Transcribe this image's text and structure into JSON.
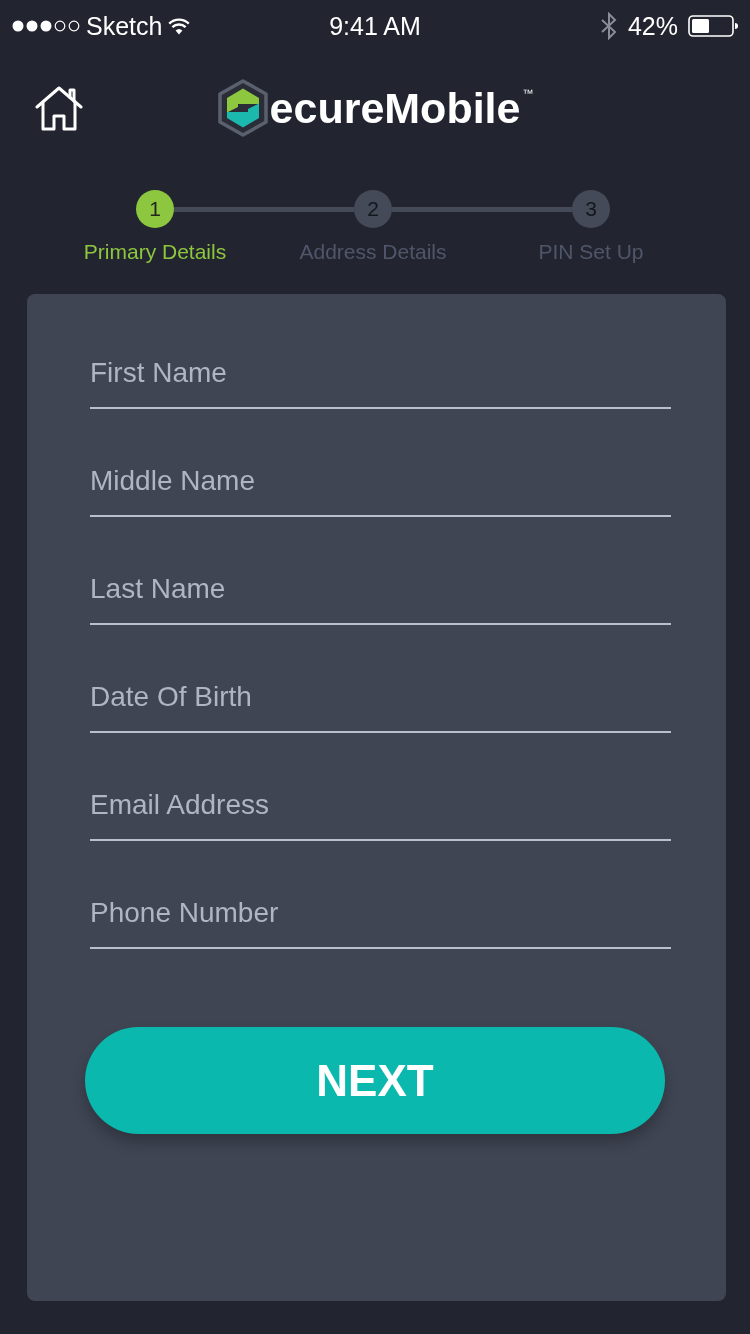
{
  "status_bar": {
    "carrier": "Sketch",
    "time": "9:41 AM",
    "battery": "42%"
  },
  "header": {
    "logo_text": "ecureMobile",
    "trademark": "™"
  },
  "steps": [
    {
      "number": "1",
      "label": "Primary Details",
      "selected": true
    },
    {
      "number": "2",
      "label": "Address Details",
      "selected": false
    },
    {
      "number": "3",
      "label": "PIN Set Up",
      "selected": false
    }
  ],
  "form": {
    "fields": [
      {
        "placeholder": "First Name"
      },
      {
        "placeholder": "Middle Name"
      },
      {
        "placeholder": "Last Name"
      },
      {
        "placeholder": "Date Of Birth"
      },
      {
        "placeholder": "Email Address"
      },
      {
        "placeholder": "Phone Number"
      }
    ],
    "submit": "NEXT"
  }
}
